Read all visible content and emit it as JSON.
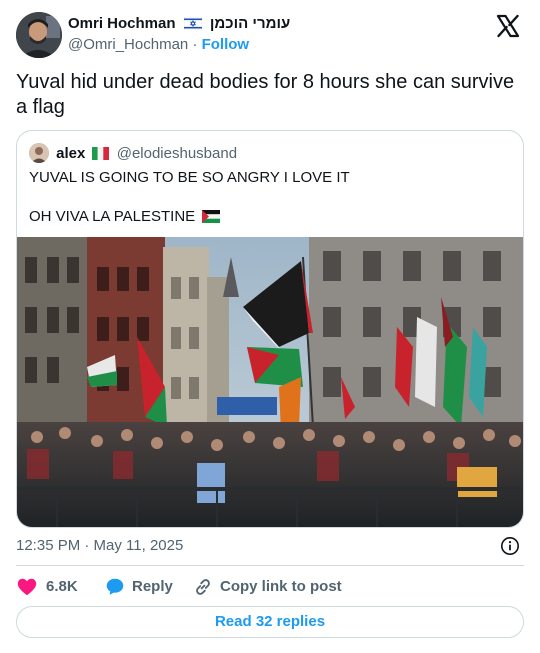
{
  "author": {
    "name": "Omri Hochman",
    "hebrew_name": "עומרי הוכמן",
    "flag_icon": "israel-flag-icon",
    "handle": "@Omri_Hochman",
    "separator": "·",
    "follow_label": "Follow"
  },
  "logo_icon": "x-logo-icon",
  "tweet": {
    "text": "Yuval hid under dead bodies for 8 hours she can survive a flag"
  },
  "quoted": {
    "name": "alex",
    "flag_icon": "italy-flag-icon",
    "handle": "@elodieshusband",
    "line1": "YUVAL IS GOING TO BE SO ANGRY I LOVE IT",
    "line2": "OH VIVA LA PALESTINE",
    "line2_flag_icon": "palestine-flag-icon",
    "media_icon": "protest-crowd-image"
  },
  "meta": {
    "timestamp": "12:35 PM · May 11, 2025",
    "info_icon": "info-icon"
  },
  "actions": {
    "like_count": "6.8K",
    "reply_label": "Reply",
    "copy_label": "Copy link to post"
  },
  "read_replies_label": "Read 32 replies",
  "colors": {
    "accent": "#1d9bf0",
    "like": "#f91880",
    "secondary_text": "#536471",
    "border": "#cfd9de"
  }
}
